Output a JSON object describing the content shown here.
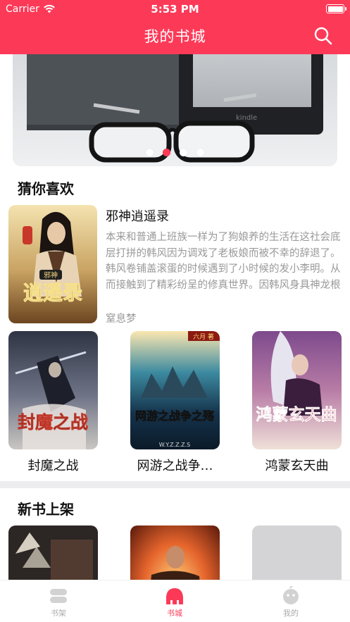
{
  "status_bar": {
    "carrier": "Carrier",
    "time": "5:53 PM"
  },
  "header": {
    "title": "我的书城",
    "search_icon": "search-icon"
  },
  "banner": {
    "dots": 4,
    "active_dot": 1
  },
  "recommend": {
    "title": "猜你喜欢",
    "featured": {
      "title": "邪神逍遥录",
      "description": "本来和普通上班族一样为了狗娘养的生活在这社会底层打拼的韩风因为调戏了老板娘而被不幸的辞退了。韩风卷铺盖滚蛋的时候遇到了小时候的发小李明。从而接触到了精彩纷呈的修真世界。因韩风身具神龙根从而踏入了双修之途。从此…",
      "author": "窒息梦",
      "cover_text": "逍遥录",
      "cover_tag": "邪神"
    },
    "books": [
      {
        "name": "封魔之战",
        "cover_text": "封魔之战"
      },
      {
        "name": "网游之战争…",
        "cover_text": "网游之战争之殇",
        "cover_sub": "W.Y.Z.Z.Z.S",
        "cover_tag": "六月 著"
      },
      {
        "name": "鸿蒙玄天曲",
        "cover_text": "鸿蒙玄天曲"
      }
    ]
  },
  "new_books": {
    "title": "新书上架"
  },
  "tabbar": {
    "items": [
      {
        "label": "书架",
        "icon": "bookshelf-icon"
      },
      {
        "label": "书城",
        "icon": "bookstore-icon"
      },
      {
        "label": "我的",
        "icon": "profile-icon"
      }
    ]
  },
  "colors": {
    "accent": "#fc3a58",
    "muted_text": "#999999"
  }
}
